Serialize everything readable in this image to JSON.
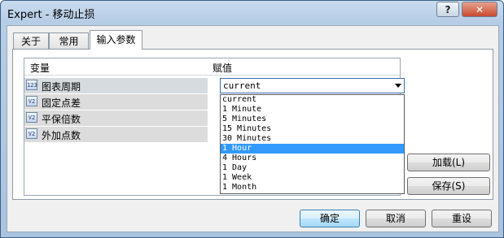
{
  "window": {
    "title": "Expert - 移动止损",
    "help_label": "?",
    "close_label": "✕"
  },
  "tabs": [
    {
      "label": "关于"
    },
    {
      "label": "常用"
    },
    {
      "label": "输入参数"
    }
  ],
  "grid": {
    "col_variable": "变量",
    "col_value": "赋值",
    "rows": [
      {
        "icon": "123",
        "icon_name": "int-type-icon",
        "label": "图表周期"
      },
      {
        "icon": "V2",
        "icon_name": "double-type-icon",
        "label": "固定点差"
      },
      {
        "icon": "V2",
        "icon_name": "double-type-icon",
        "label": "平保倍数"
      },
      {
        "icon": "V2",
        "icon_name": "double-type-icon",
        "label": "外加点数"
      }
    ]
  },
  "combo": {
    "value": "current",
    "options": [
      "current",
      "1 Minute",
      "5 Minutes",
      "15 Minutes",
      "30 Minutes",
      "1 Hour",
      "4 Hours",
      "1 Day",
      "1 Week",
      "1 Month"
    ],
    "highlighted": "1 Hour"
  },
  "side_buttons": {
    "load": "加载(L)",
    "save": "保存(S)"
  },
  "bottom_buttons": {
    "ok": "确定",
    "cancel": "取消",
    "reset": "重设"
  },
  "colors": {
    "selection": "#3399ff",
    "title_gradient": "#b6cde6",
    "close_button": "#c74a30"
  }
}
